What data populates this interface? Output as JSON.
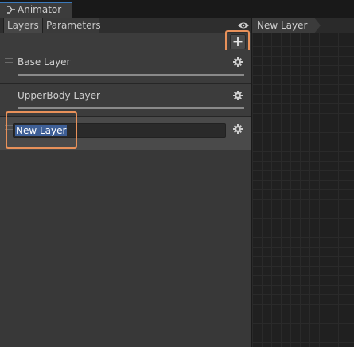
{
  "window": {
    "tab_title": "Animator",
    "tab_icon": "animator-icon"
  },
  "subtabs": [
    {
      "label": "Layers",
      "active": true
    },
    {
      "label": "Parameters",
      "active": false
    }
  ],
  "toolbar": {
    "visibility_icon": "eye-icon",
    "add_icon": "plus-icon"
  },
  "layers": [
    {
      "name": "Base Layer"
    },
    {
      "name": "UpperBody Layer"
    },
    {
      "name": "New Layer",
      "editing": true
    }
  ],
  "breadcrumb": {
    "current": "New Layer"
  },
  "colors": {
    "highlight": "#e8915a",
    "selection": "#3e5f96",
    "tab_accent": "#3a79bb"
  }
}
